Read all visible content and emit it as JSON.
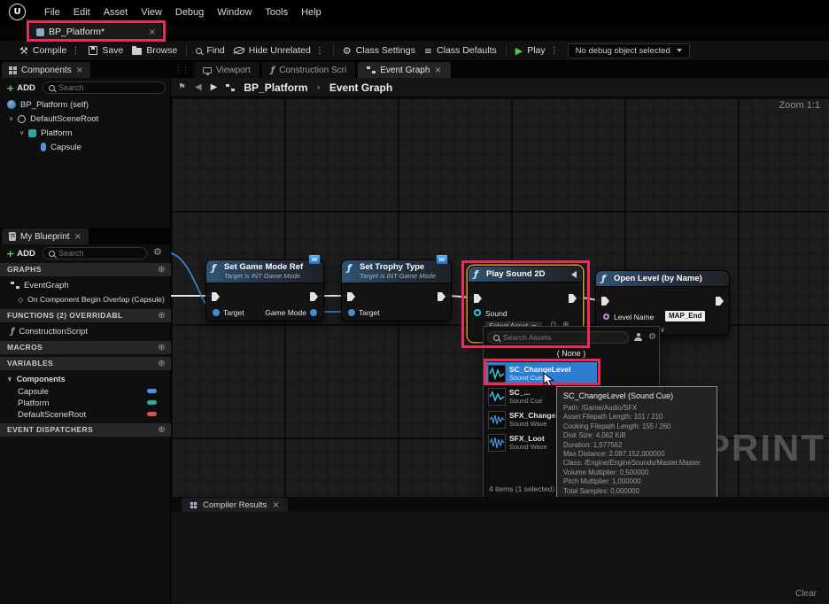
{
  "colors": {
    "annotation": "#ed2a5e",
    "selection_blue": "#2d7dd2",
    "play_green": "#58c158",
    "node_header_blue": "#2f5573",
    "wire_white": "#e6e6e6",
    "wire_blue": "#3f8fd4"
  },
  "icons": {
    "close": "×",
    "kebab": "⋮",
    "gear": "⚙",
    "plus": "+",
    "circle_plus": "⊕",
    "chevron_down": "∨",
    "chevron_right": "›",
    "back": "◀",
    "forward": "▶",
    "play": "▶",
    "flag": "⚑",
    "fn": "ƒ",
    "event_diamond": "◇",
    "defaults": "≡",
    "envelope": "✉",
    "use_selected": "⊙",
    "browse_asset": "⊕",
    "hammer": "⚒",
    "logo": "U"
  },
  "menubar": {
    "items": [
      "File",
      "Edit",
      "Asset",
      "View",
      "Debug",
      "Window",
      "Tools",
      "Help"
    ]
  },
  "asset_tab": {
    "label": "BP_Platform*"
  },
  "toolbar": {
    "compile": "Compile",
    "save": "Save",
    "browse": "Browse",
    "find": "Find",
    "hide_unrelated": "Hide Unrelated",
    "class_settings": "Class Settings",
    "class_defaults": "Class Defaults",
    "play": "Play",
    "debug_select": "No debug object selected"
  },
  "components_panel": {
    "title": "Components",
    "add_label": "ADD",
    "search_placeholder": "Search",
    "items": [
      {
        "label": "BP_Platform (self)"
      },
      {
        "label": "DefaultSceneRoot"
      },
      {
        "label": "Platform"
      },
      {
        "label": "Capsule"
      }
    ]
  },
  "my_blueprint": {
    "title": "My Blueprint",
    "add_label": "ADD",
    "search_placeholder": "Search",
    "graphs_header": "GRAPHS",
    "eventgraph": "EventGraph",
    "overlap_event": "On Component Begin Overlap (Capsule)",
    "functions_header": "FUNCTIONS (2) OVERRIDABL",
    "construction_script": "ConstructionScript",
    "macros_header": "MACROS",
    "variables_header": "VARIABLES",
    "components_group": "Components",
    "var_capsule": "Capsule",
    "var_platform": "Platform",
    "var_defaultsceneroot": "DefaultSceneRoot",
    "event_dispatchers_header": "EVENT DISPATCHERS"
  },
  "graph": {
    "tabs": [
      {
        "label": "Viewport"
      },
      {
        "label": "Construction Scri"
      },
      {
        "label": "Event Graph"
      }
    ],
    "breadcrumb_root": "BP_Platform",
    "breadcrumb_current": "Event Graph",
    "zoom_label": "Zoom 1:1",
    "watermark": "BLUEPRINT",
    "nodes": {
      "set_game_mode_ref": {
        "title": "Set Game Mode Ref",
        "subtitle": "Target is INT Game Mode",
        "target_pin": "Target",
        "game_mode_pin": "Game Mode"
      },
      "set_trophy_type": {
        "title": "Set Trophy Type",
        "subtitle": "Target is INT Game Mode",
        "target_pin": "Target"
      },
      "play_sound_2d": {
        "title": "Play Sound 2D",
        "sound_pin": "Sound",
        "select_asset": "Select Asset"
      },
      "open_level": {
        "title": "Open Level (by Name)",
        "level_name_pin": "Level Name",
        "level_name_value": "MAP_End"
      }
    },
    "asset_picker": {
      "search_placeholder": "Search Assets",
      "none_option": "( None )",
      "items": [
        {
          "name": "SC_ChangeLevel",
          "type": "Sound Cue"
        },
        {
          "name": "SC_...",
          "type": "Sound Cue"
        },
        {
          "name": "SFX_Change...",
          "type": "Sound Wave"
        },
        {
          "name": "SFX_Loot",
          "type": "Sound Wave"
        }
      ],
      "footer": "4 items (1 selected)"
    },
    "asset_tooltip": {
      "title": "SC_ChangeLevel (Sound Cue)",
      "lines": [
        "Path: /Game/Audio/SFX",
        "Asset Filepath Length: 101 / 210",
        "Cooking Filepath Length: 155 / 260",
        "Disk Size: 4,062 KiB",
        "Duration: 1,577562",
        "Max Distance: 2.097.152,000000",
        "Class: /Engine/EngineSounds/Master.Master",
        "Volume Multiplier: 0,500000",
        "Pitch Multiplier: 1,000000",
        "Total Samples: 0,000000"
      ]
    },
    "compiler_results_tab": "Compiler Results",
    "clear_button": "Clear"
  }
}
